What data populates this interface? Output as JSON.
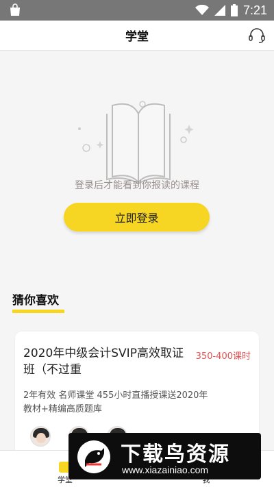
{
  "status_bar": {
    "time": "7:21"
  },
  "header": {
    "title": "学堂"
  },
  "empty_state": {
    "message": "登录后才能看到你报读的课程",
    "login_button": "立即登录"
  },
  "recommend": {
    "section_title": "猜你喜欢",
    "card": {
      "title": "2020年中级会计SVIP高效取证班（不过重",
      "hours": "350-400课时",
      "description": "2年有效 名师课堂 455小时直播授课送2020年教材+精编高质题库"
    }
  },
  "tabbar": {
    "items": [
      {
        "label": "学堂",
        "active": true
      },
      {
        "label": "我"
      }
    ]
  },
  "watermark": {
    "title": "下载鸟资源",
    "url": "www.xiazainiao.com"
  },
  "colors": {
    "accent": "#f6d523",
    "price": "#e25151",
    "status_bar": "#777777"
  }
}
